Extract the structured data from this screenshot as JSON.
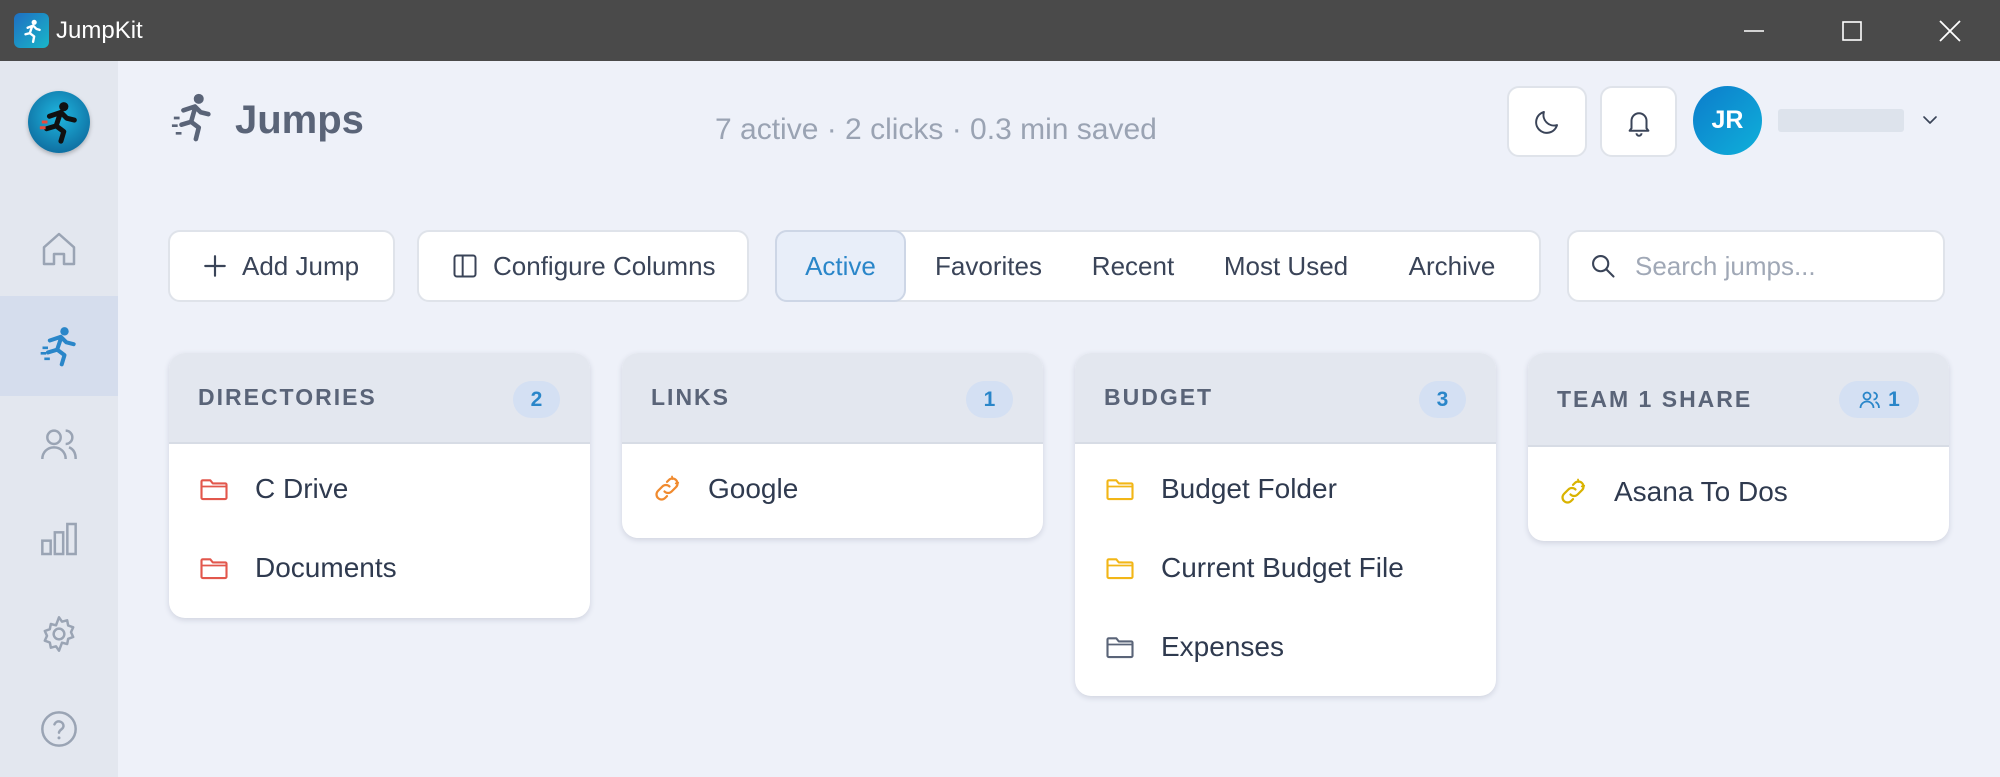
{
  "window": {
    "title": "JumpKit"
  },
  "sidebar": {
    "items": [
      {
        "icon": "home-icon"
      },
      {
        "icon": "jumper-icon",
        "active": true
      },
      {
        "icon": "users-icon"
      },
      {
        "icon": "chart-icon"
      },
      {
        "icon": "gear-icon"
      },
      {
        "icon": "help-icon"
      }
    ]
  },
  "header": {
    "title": "Jumps",
    "stats": "7 active · 2 clicks · 0.3 min saved",
    "user_initials": "JR"
  },
  "toolbar": {
    "add_label": "Add Jump",
    "configure_label": "Configure Columns",
    "tabs": [
      "Active",
      "Favorites",
      "Recent",
      "Most Used",
      "Archive"
    ],
    "active_tab": "Active",
    "search_placeholder": "Search jumps..."
  },
  "colors": {
    "accent": "#2a86c9",
    "folder_red": "#e2574c",
    "folder_yellow": "#f2b617",
    "link_orange": "#f08a2e",
    "link_yellow": "#d9b300"
  },
  "columns": [
    {
      "title": "DIRECTORIES",
      "count": "2",
      "items": [
        {
          "label": "C Drive",
          "icon": "folder-icon"
        },
        {
          "label": "Documents",
          "icon": "folder-icon"
        }
      ]
    },
    {
      "title": "LINKS",
      "count": "1",
      "items": [
        {
          "label": "Google",
          "icon": "link-icon"
        }
      ]
    },
    {
      "title": "BUDGET",
      "count": "3",
      "items": [
        {
          "label": "Budget Folder",
          "icon": "folder-icon"
        },
        {
          "label": "Current Budget File",
          "icon": "folder-icon"
        },
        {
          "label": "Expenses",
          "icon": "folder-icon"
        }
      ]
    },
    {
      "title": "TEAM 1 SHARE",
      "count": "1",
      "shared": true,
      "items": [
        {
          "label": "Asana To Dos",
          "icon": "link-icon"
        }
      ]
    }
  ]
}
